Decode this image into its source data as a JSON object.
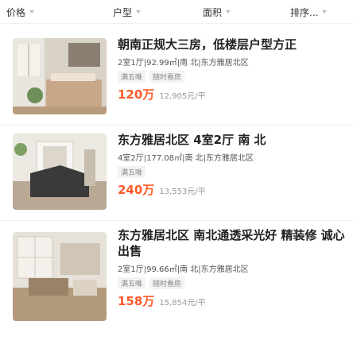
{
  "filters": [
    {
      "label": "价格"
    },
    {
      "label": "户型"
    },
    {
      "label": "面积"
    },
    {
      "label": "排序..."
    }
  ],
  "listings": [
    {
      "title": "朝南正规大三房，低楼层户型方正",
      "meta": "2室1厅|92.99㎡|南 北|东方雅居北区",
      "tags": [
        "满五唯",
        "随时看房"
      ],
      "price": "120万",
      "unit_price": "12,905元/平"
    },
    {
      "title": "东方雅居北区 4室2厅 南 北",
      "meta": "4室2厅|177.08㎡|南 北|东方雅居北区",
      "tags": [
        "满五唯"
      ],
      "price": "240万",
      "unit_price": "13,553元/平"
    },
    {
      "title": "东方雅居北区 南北通透采光好 精装修 诚心出售",
      "meta": "2室1厅|99.66㎡|南 北|东方雅居北区",
      "tags": [
        "满五唯",
        "随时看房"
      ],
      "price": "158万",
      "unit_price": "15,854元/平"
    }
  ]
}
